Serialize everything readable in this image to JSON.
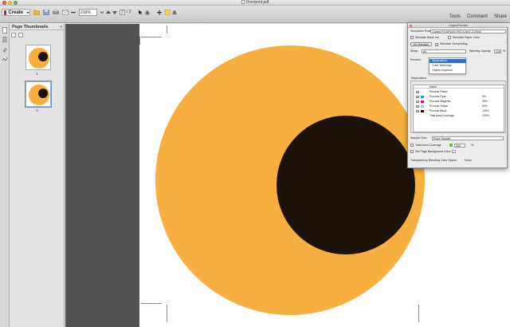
{
  "window": {
    "title": "Overprint.pdf"
  },
  "toolbar": {
    "create_label": "Create",
    "page_current": "2",
    "page_total": "/ 2",
    "zoom": "216%",
    "tools": "Tools",
    "comment": "Comment",
    "share": "Share"
  },
  "thumbnails": {
    "title": "Page Thumbnails",
    "close": "x",
    "pages": [
      {
        "label": "1"
      },
      {
        "label": "2"
      }
    ]
  },
  "document": {
    "outer_circle_color": "#f7b03f",
    "inner_circle_color": "#1c1209"
  },
  "output_preview": {
    "title": "Output Preview",
    "simulation_profile_label": "Simulation Profile:",
    "simulation_profile_value": "Coated FOGRA39 (ISO 12647-2:2004)",
    "simulate_black_ink": "Simulate Black Ink",
    "simulate_paper_color": "Simulate Paper Color",
    "ink_manager": "Ink Manager",
    "simulate_overprinting": "Simulate Overprinting",
    "show_label": "Show:",
    "show_value": "All",
    "warning_opacity_label": "Warning Opacity:",
    "warning_opacity_value": "100",
    "warning_opacity_unit": "%",
    "preview_label": "Preview:",
    "preview_options": [
      "Separations",
      "Color Warnings",
      "Object Inspector"
    ],
    "separations_label": "Separations",
    "name_header": "Name",
    "separations": [
      {
        "name": "Process Plates",
        "value": "",
        "color": ""
      },
      {
        "name": "Process Cyan",
        "value": "0%",
        "color": "#00aeef"
      },
      {
        "name": "Process Magenta",
        "value": "33%",
        "color": "#ec008c"
      },
      {
        "name": "Process Yellow",
        "value": "83%",
        "color": "#fff200"
      },
      {
        "name": "Process Black",
        "value": "100%",
        "color": "#111111"
      },
      {
        "name": "Total Area Coverage",
        "value": "220%",
        "color": ""
      }
    ],
    "sample_size_label": "Sample Size:",
    "sample_size_value": "Point Sample",
    "total_area_coverage": "Total Area Coverage",
    "tac_value": "300",
    "tac_unit": "%",
    "tac_swatch_color": "#5ac840",
    "set_page_bg": "Set Page Background Color",
    "transparency_label": "Transparency Blending Color Space:",
    "transparency_value": "None"
  }
}
